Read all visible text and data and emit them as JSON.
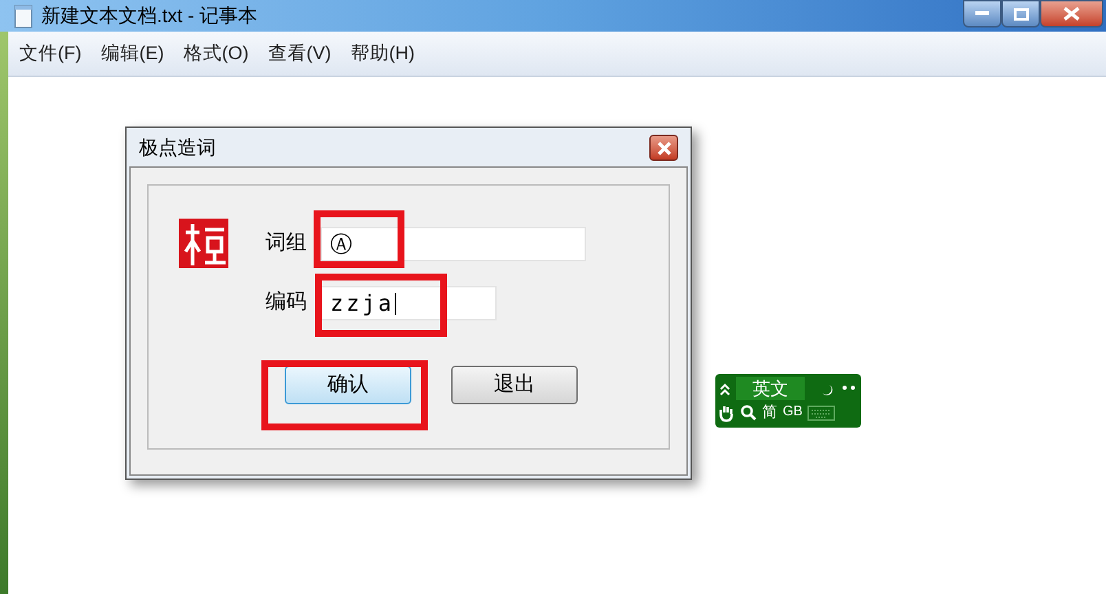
{
  "window": {
    "title": "新建文本文档.txt - 记事本"
  },
  "menu": [
    "文件(F)",
    "编辑(E)",
    "格式(O)",
    "查看(V)",
    "帮助(H)"
  ],
  "dialog": {
    "title": "极点造词",
    "fields": [
      {
        "label": "词组",
        "value": "Ⓐ",
        "highlighted": true
      },
      {
        "label": "编码",
        "value": "zzja",
        "highlighted": true
      }
    ],
    "buttons": [
      {
        "label": "确认",
        "default": true,
        "highlighted": true
      },
      {
        "label": "退出",
        "default": false,
        "highlighted": false
      }
    ]
  },
  "ime_bar": {
    "mode": "英文",
    "script": "简",
    "charset": "GB"
  }
}
